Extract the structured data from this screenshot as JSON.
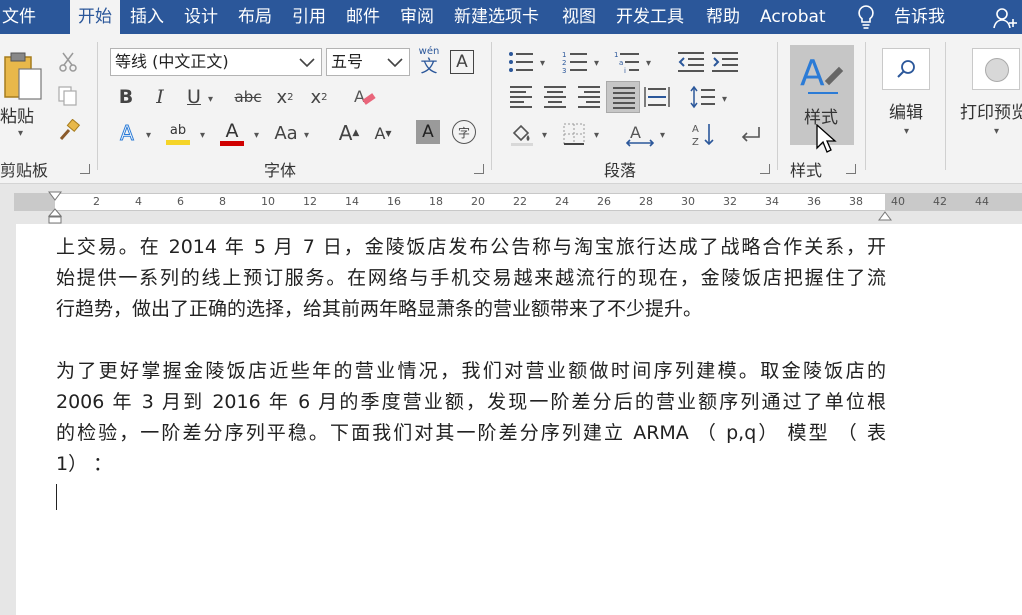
{
  "tabs": {
    "file": "文件",
    "home": "开始",
    "insert": "插入",
    "design": "设计",
    "layout": "布局",
    "references": "引用",
    "mailings": "邮件",
    "review": "审阅",
    "new_tab": "新建选项卡",
    "view": "视图",
    "developer": "开发工具",
    "help": "帮助",
    "acrobat": "Acrobat",
    "tell_me": "告诉我"
  },
  "clipboard": {
    "paste_label": "粘贴",
    "group_label": "剪贴板"
  },
  "font": {
    "font_name": "等线 (中文正文)",
    "font_size": "五号",
    "phonetic_top": "wén",
    "phonetic_bottom": "文",
    "char_border": "A",
    "bold": "B",
    "italic": "I",
    "underline": "U",
    "strike": "abc",
    "subscript": "x",
    "subscript_mark": "2",
    "superscript": "x",
    "superscript_mark": "2",
    "text_effect": "A",
    "highlight": "ab",
    "font_color": "A",
    "change_case": "Aa",
    "grow": "A",
    "shrink": "A",
    "char_shading": "A",
    "enclose": "字",
    "group_label": "字体"
  },
  "paragraph": {
    "group_label": "段落"
  },
  "styles": {
    "styles_label": "样式",
    "group_label": "样式"
  },
  "editing": {
    "label": "编辑"
  },
  "print": {
    "label": "打印预览"
  },
  "ruler": {
    "marks": [
      "2",
      "4",
      "6",
      "8",
      "10",
      "12",
      "14",
      "16",
      "18",
      "20",
      "22",
      "24",
      "26",
      "28",
      "30",
      "32",
      "34",
      "36",
      "38",
      "40",
      "42",
      "44"
    ]
  },
  "document": {
    "para1": [
      "上交易。在 2014 年 5 月 7 日，金陵饭店发布公告称与淘宝旅行达成了战略合作关系，开",
      "始提供一系列的线上预订服务。在网络与手机交易越来越流行的现在，金陵饭店把握住了流",
      "行趋势，做出了正确的选择，给其前两年略显萧条的营业额带来了不少提升。"
    ],
    "para2": [
      "为了更好掌握金陵饭店近些年的营业情况，我们对营业额做时间序列建模。取金陵饭店的",
      "2006 年 3 月到 2016 年 6 月的季度营业额，发现一阶差分后的营业额序列通过了单位根",
      "的检验，一阶差分序列平稳。下面我们对其一阶差分序列建立 ARMA （ p,q） 模型 （ 表",
      "1） ："
    ]
  }
}
